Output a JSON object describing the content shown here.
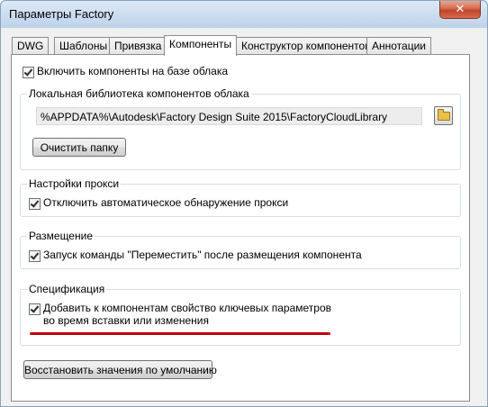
{
  "window": {
    "title": "Параметры Factory",
    "close_glyph": "✕"
  },
  "tabs": [
    {
      "label": "DWG"
    },
    {
      "label": "Шаблоны"
    },
    {
      "label": "Привязка"
    },
    {
      "label": "Компоненты",
      "active": true
    },
    {
      "label": "Конструктор компонентов"
    },
    {
      "label": "Аннотации"
    }
  ],
  "cloud": {
    "enable_label": "Включить компоненты на базе облака",
    "checked": true
  },
  "library": {
    "title": "Локальная библиотека компонентов облака",
    "path": "%APPDATA%\\Autodesk\\Factory Design Suite 2015\\FactoryCloudLibrary",
    "browse_icon": "folder-icon",
    "clear_button": "Очистить папку"
  },
  "proxy": {
    "title": "Настройки прокси",
    "disable_label": "Отключить автоматическое обнаружение прокси",
    "checked": true
  },
  "placement": {
    "title": "Размещение",
    "move_label": "Запуск команды \"Переместить\" после размещения компонента",
    "checked": true
  },
  "spec": {
    "title": "Спецификация",
    "add_label_line1": "Добавить к компонентам свойство ключевых параметров",
    "add_label_line2": "во время вставки или изменения",
    "checked": true,
    "underline_color": "#c0000a"
  },
  "restore_button": "Восстановить значения по умолчанию"
}
